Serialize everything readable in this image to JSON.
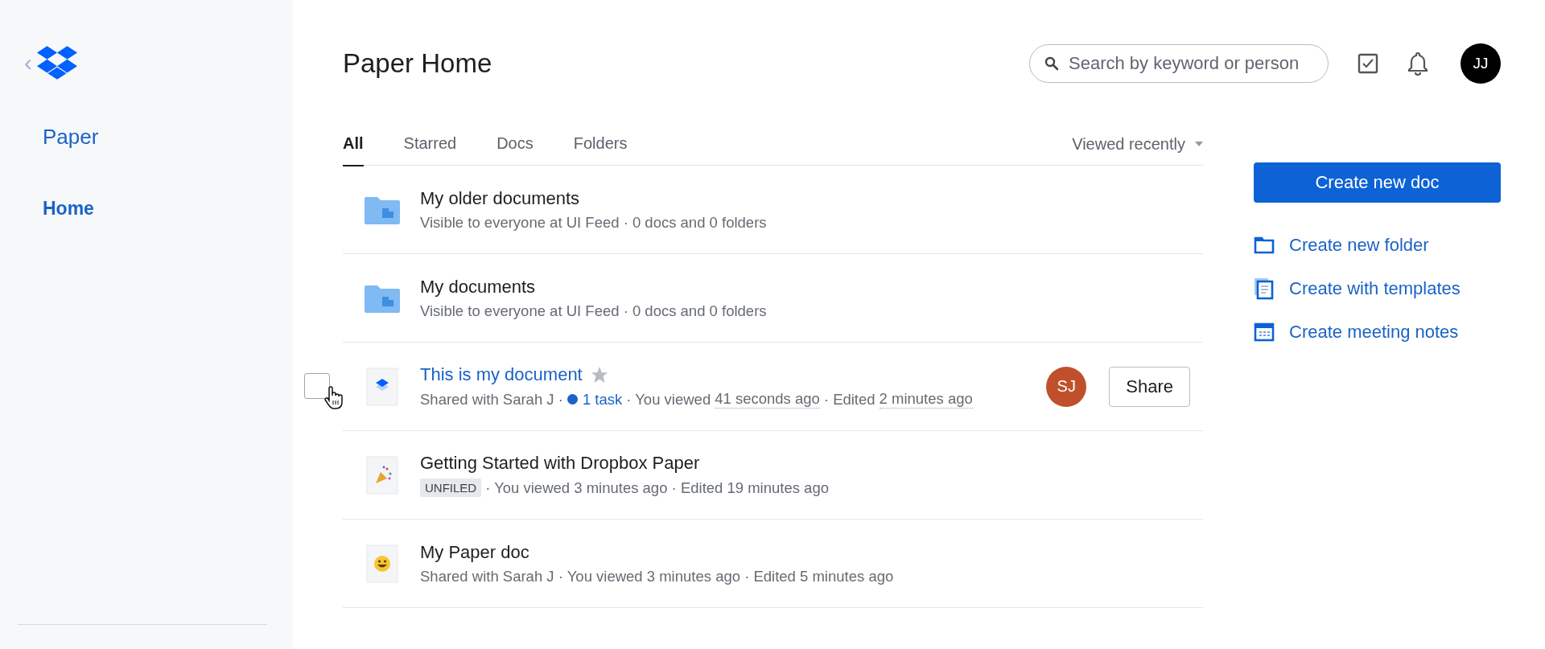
{
  "sidebar": {
    "back": "‹",
    "app_name": "Paper",
    "items": [
      {
        "label": "Home",
        "selected": true
      }
    ]
  },
  "header": {
    "title": "Paper Home",
    "search": {
      "placeholder": "Search by keyword or person"
    },
    "account": {
      "initials": "JJ"
    }
  },
  "tabs": [
    {
      "label": "All",
      "selected": true
    },
    {
      "label": "Starred",
      "selected": false
    },
    {
      "label": "Docs",
      "selected": false
    },
    {
      "label": "Folders",
      "selected": false
    }
  ],
  "sort": {
    "label": "Viewed recently"
  },
  "rows": [
    {
      "kind": "folder",
      "title": "My older documents",
      "hovered": false,
      "meta": [
        {
          "kind": "text",
          "text": "Visible to everyone at UI Feed · 0 docs and 0 folders"
        }
      ]
    },
    {
      "kind": "folder",
      "title": "My documents",
      "hovered": false,
      "meta": [
        {
          "kind": "text",
          "text": "Visible to everyone at UI Feed · 0 docs and 0 folders"
        }
      ]
    },
    {
      "kind": "layers",
      "title": "This is my document",
      "hovered": true,
      "checked": false,
      "starred": false,
      "avatar": "SJ",
      "share": "Share",
      "meta": [
        {
          "kind": "text",
          "text": "Shared with Sarah J ·"
        },
        {
          "kind": "task",
          "text": "1 task"
        },
        {
          "kind": "text",
          "text": "· You viewed"
        },
        {
          "kind": "time",
          "text": "41 seconds ago"
        },
        {
          "kind": "text",
          "text": "· Edited"
        },
        {
          "kind": "time",
          "text": "2 minutes ago"
        }
      ]
    },
    {
      "kind": "party",
      "title": "Getting Started with Dropbox Paper",
      "hovered": false,
      "meta": [
        {
          "kind": "tag",
          "text": "UNFILED"
        },
        {
          "kind": "text",
          "text": "· You viewed 3 minutes ago · Edited 19 minutes ago"
        }
      ]
    },
    {
      "kind": "smiley",
      "title": "My Paper doc",
      "hovered": false,
      "meta": [
        {
          "kind": "text",
          "text": "Shared with Sarah J · You viewed 3 minutes ago · Edited 5 minutes ago"
        }
      ]
    }
  ],
  "actions": {
    "primary": "Create new doc",
    "links": [
      {
        "kind": "folder",
        "label": "Create new folder"
      },
      {
        "kind": "templates",
        "label": "Create with templates"
      },
      {
        "kind": "calendar",
        "label": "Create meeting notes"
      }
    ]
  }
}
